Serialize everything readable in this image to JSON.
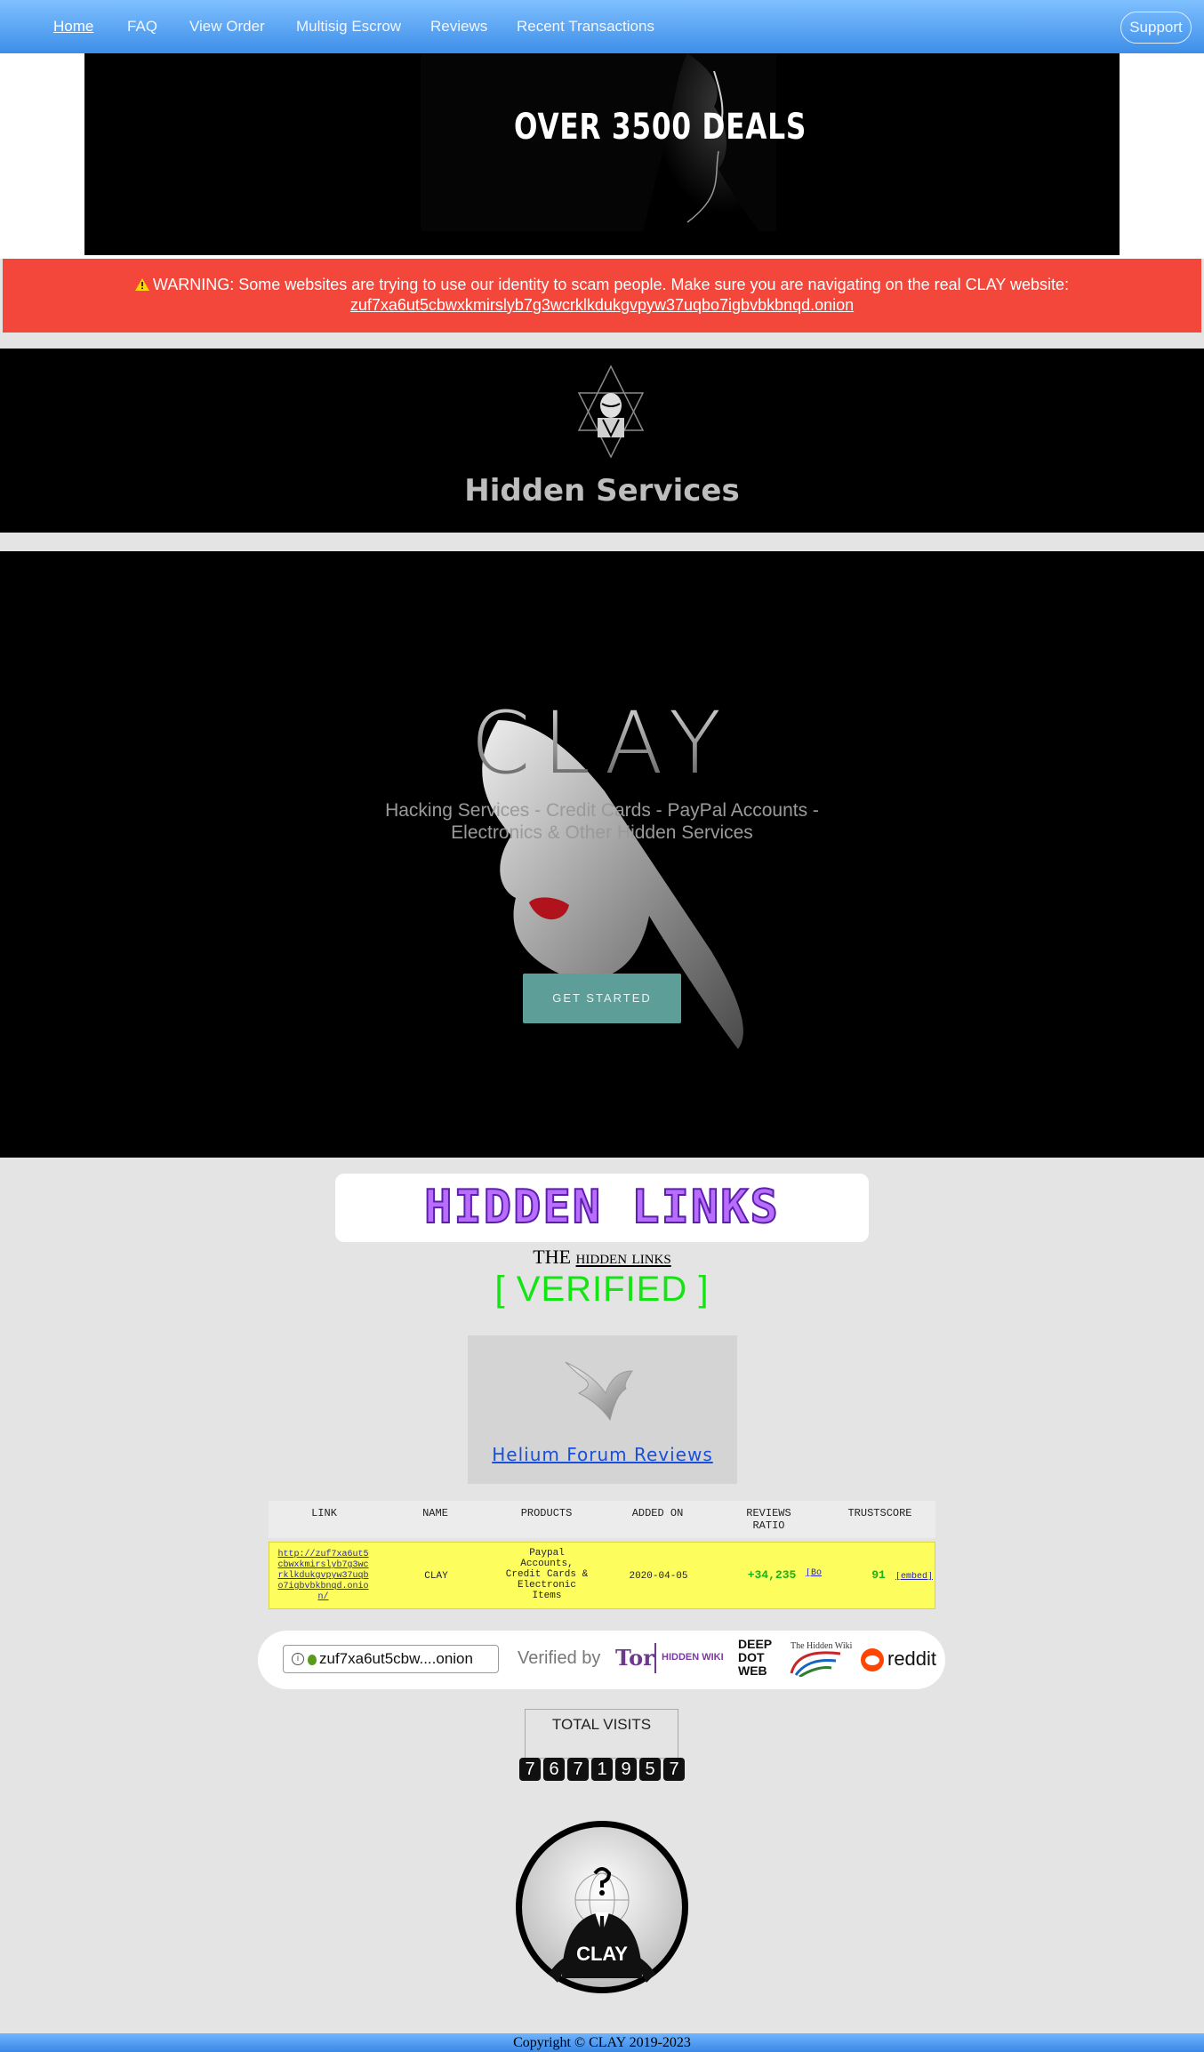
{
  "nav": {
    "items": [
      {
        "label": "Home",
        "active": true
      },
      {
        "label": "FAQ"
      },
      {
        "label": "View Order"
      },
      {
        "label": "Multisig Escrow"
      },
      {
        "label": "Reviews"
      },
      {
        "label": "Recent Transactions"
      }
    ],
    "support_label": "Support"
  },
  "banner": {
    "text": "OVER 3500 DEALS"
  },
  "warning": {
    "icon": "warning-triangle-icon",
    "strong": "WARNING:",
    "message": " Some websites are trying to use our identity to scam people. Make sure you are navigating on the real CLAY website:",
    "link": "zuf7xa6ut5cbwxkmirslyb7g3wcrklkdukgvpyw37uqbo7igbvbkbnqd.onion"
  },
  "hidden_services": {
    "title": "Hidden Services"
  },
  "hero": {
    "title": "CLAY",
    "subtitle": "Hacking Services - Credit Cards - PayPal Accounts - Electronics & Other Hidden Services",
    "cta": "GET STARTED"
  },
  "links_section": {
    "logo_text": "HIDDEN LINKS",
    "the": "THE",
    "hidden_links": "hidden links",
    "verified": "[ VERIFIED ]",
    "helium_link": "Helium Forum Reviews"
  },
  "table": {
    "headers": [
      "LINK",
      "NAME",
      "PRODUCTS",
      "ADDED ON",
      "REVIEWS RATIO",
      "TRUSTSCORE"
    ],
    "row": {
      "link": "http://zuf7xa6ut5cbwxkmirslyb7g3wcrklkdukgvpyw37uqbo7igbvbkbnqd.onion/",
      "name": "CLAY",
      "products": "Paypal Accounts, Credit Cards & Electronic Items",
      "added_on": "2020-04-05",
      "reviews": "+34,235",
      "reviews_tag": "[Bo",
      "trustscore": "91",
      "embed": "[embed]"
    }
  },
  "verified_bar": {
    "url": "zuf7xa6ut5cbw....onion",
    "verified_by": "Verified by",
    "badges": [
      "Tor",
      "HIDDEN WIKI",
      "DEEP DOT WEB",
      "The Hidden Wiki",
      "reddit"
    ]
  },
  "counter": {
    "label": "TOTAL VISITS",
    "digits": [
      "7",
      "6",
      "7",
      "1",
      "9",
      "5",
      "7"
    ]
  },
  "emblem_text": "CLAY",
  "footer": {
    "copyright": "Copyright © CLAY 2019-2023"
  },
  "colors": {
    "nav": "#4a9af0",
    "warning": "#f2473a",
    "cta": "#5e9e99",
    "verified": "#14e314",
    "row": "#fefd5e"
  }
}
